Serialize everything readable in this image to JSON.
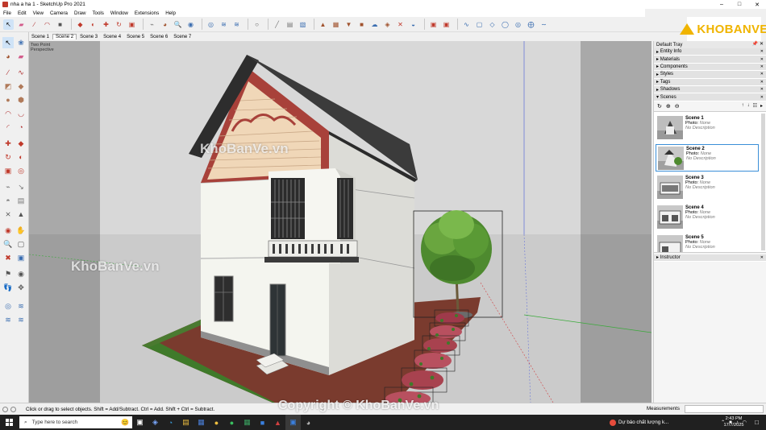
{
  "window": {
    "title": "nha a ha 1 - SketchUp Pro 2021",
    "min": "–",
    "max": "□",
    "close": "✕"
  },
  "menu": [
    "File",
    "Edit",
    "View",
    "Camera",
    "Draw",
    "Tools",
    "Window",
    "Extensions",
    "Help"
  ],
  "scene_tabs": [
    {
      "label": "Scene 1",
      "active": false
    },
    {
      "label": "Scene 2",
      "active": true
    },
    {
      "label": "Scene 3",
      "active": false
    },
    {
      "label": "Scene 4",
      "active": false
    },
    {
      "label": "Scene 5",
      "active": false
    },
    {
      "label": "Scene 6",
      "active": false
    },
    {
      "label": "Scene 7",
      "active": false
    }
  ],
  "viewport": {
    "camera_label_1": "Two Point",
    "camera_label_2": "Perspective"
  },
  "logo": {
    "text": "KHOBANVE"
  },
  "tray": {
    "title": "Default Tray",
    "pin": "📌 ✕",
    "panels": [
      "Entity Info",
      "Materials",
      "Components",
      "Styles",
      "Tags",
      "Shadows",
      "Scenes"
    ],
    "instructor": "Instructor",
    "scenes": [
      {
        "name": "Scene 1",
        "photo": "Photo:",
        "photo_val": "None",
        "desc": "No Description",
        "selected": false
      },
      {
        "name": "Scene 2",
        "photo": "Photo:",
        "photo_val": "None",
        "desc": "No Description",
        "selected": true
      },
      {
        "name": "Scene 3",
        "photo": "Photo:",
        "photo_val": "None",
        "desc": "No Description",
        "selected": false
      },
      {
        "name": "Scene 4",
        "photo": "Photo:",
        "photo_val": "None",
        "desc": "No Description",
        "selected": false
      },
      {
        "name": "Scene 5",
        "photo": "Photo:",
        "photo_val": "None",
        "desc": "No Description",
        "selected": false
      }
    ]
  },
  "status": {
    "hint": "Click or drag to select objects. Shift = Add/Subtract. Ctrl = Add. Shift + Ctrl = Subtract.",
    "measurements_label": "Measurements",
    "copyright_watermark": "Copyright © KhoBanVe.vn"
  },
  "watermarks": {
    "top": "KhoBanVe.vn",
    "left": "KhoBanVe.vn"
  },
  "taskbar": {
    "search_placeholder": "Type here to search",
    "weather": "Dự báo chất lượng k...",
    "time": "2:43 PM",
    "date": "17/7/2025"
  },
  "colors": {
    "accent": "#3a8fd8",
    "sky": "#d9d9d9",
    "ground": "#cfcfcf",
    "tile": "#7a3b2e",
    "roof": "#2d2d2d",
    "gable_red": "#a8413a",
    "wall": "#f4f5ef"
  }
}
